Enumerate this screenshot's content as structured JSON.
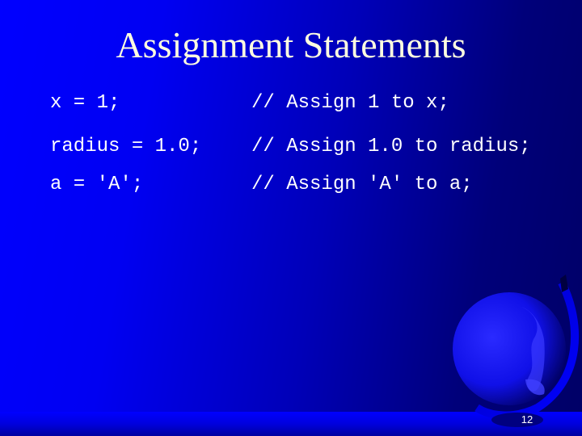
{
  "slide": {
    "title": "Assignment Statements",
    "statements": [
      {
        "code": "x = 1;",
        "comment": "// Assign 1 to x;"
      },
      {
        "code": "radius = 1.0;",
        "comment": "// Assign 1.0 to radius;"
      },
      {
        "code": "a = 'A';",
        "comment": "// Assign 'A' to a;"
      }
    ],
    "page_number": "12",
    "decoration": "globe-icon",
    "colors": {
      "background_start": "#0000ff",
      "background_end": "#000066",
      "title": "#fffde0",
      "text": "#ffffff"
    }
  }
}
